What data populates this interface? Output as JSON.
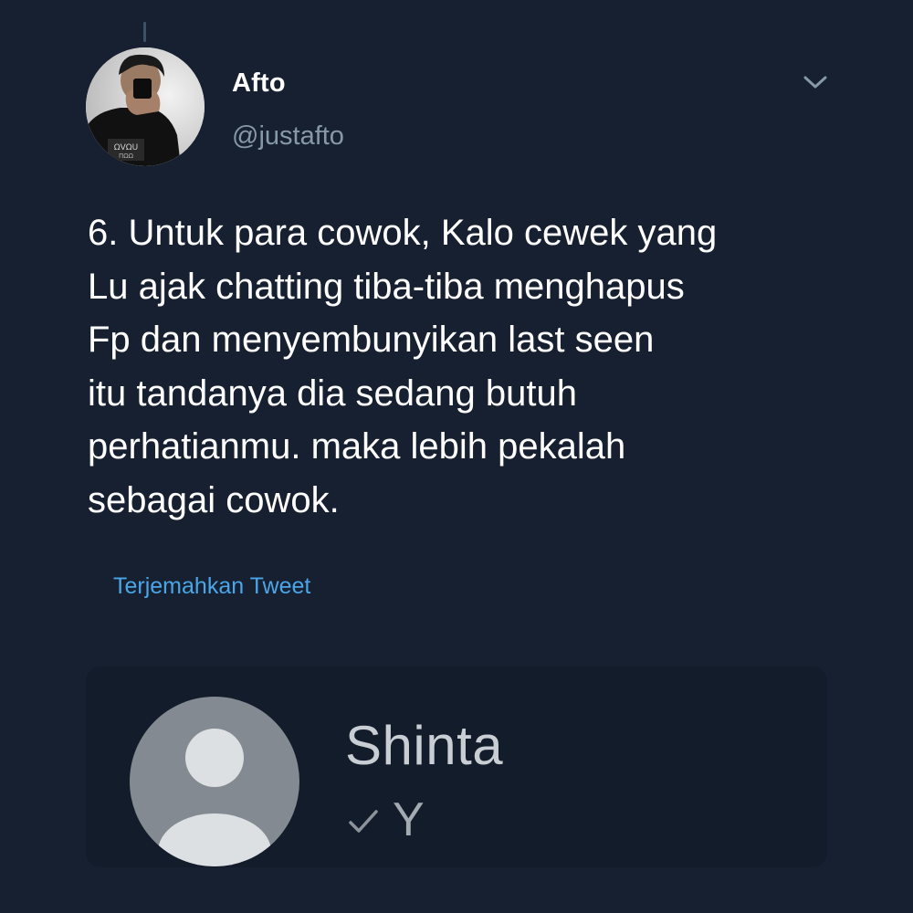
{
  "tweet": {
    "author": {
      "display_name": "Afto",
      "handle": "@justafto",
      "avatar_icon": "profile-photo"
    },
    "text_lines": [
      "6. Untuk para cowok, Kalo cewek yang",
      "Lu ajak chatting tiba-tiba menghapus",
      "Fp dan menyembunyikan last seen",
      "itu tandanya dia sedang butuh",
      "perhatianmu. maka lebih pekalah",
      "sebagai cowok."
    ],
    "translate_label": "Terjemahkan Tweet",
    "menu_icon": "chevron-down-icon"
  },
  "chat_preview": {
    "contact_name": "Shinta",
    "last_message": "Y",
    "status_icon": "single-check-icon",
    "avatar_icon": "default-person-icon"
  },
  "colors": {
    "background": "#172030",
    "card_background": "#131c2a",
    "link": "#4aa6e8",
    "secondary_text": "#8899a6"
  }
}
